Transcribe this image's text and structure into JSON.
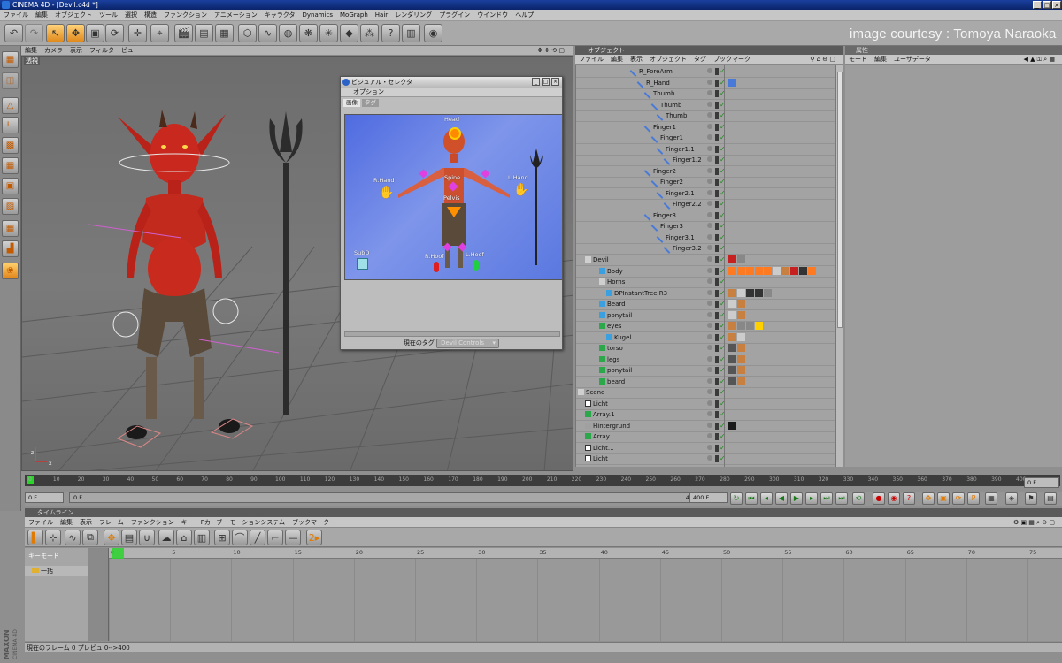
{
  "window": {
    "title": "CINEMA 4D - [Devil.c4d *]",
    "controls": [
      "_",
      "□",
      "×"
    ]
  },
  "watermark": "image courtesy : Tomoya Naraoka",
  "menubar": [
    "ファイル",
    "編集",
    "オブジェクト",
    "ツール",
    "選択",
    "構造",
    "ファンクション",
    "アニメーション",
    "キャラクタ",
    "Dynamics",
    "MoGraph",
    "Hair",
    "レンダリング",
    "プラグイン",
    "ウインドウ",
    "ヘルプ"
  ],
  "viewport": {
    "menu": [
      "編集",
      "カメラ",
      "表示",
      "フィルタ",
      "ビュー"
    ],
    "label": "透視"
  },
  "visual_selector": {
    "title": "ビジュアル・セレクタ",
    "options_menu": "オプション",
    "tabs": [
      "画像",
      "タグ"
    ],
    "labels": {
      "head": "Head",
      "spine": "Spine",
      "pelvis": "Pelvis",
      "r_hand": "R.Hand",
      "l_hand": "L.Hand",
      "subd": "SubD",
      "r_hoof": "R.Hoof",
      "l_hoof": "L.Hoof"
    },
    "current_tag_label": "現在のタグ",
    "current_tag_value": "Devil Controls"
  },
  "object_manager": {
    "title": "オブジェクト",
    "menu": [
      "ファイル",
      "編集",
      "表示",
      "オブジェクト",
      "タグ",
      "ブックマーク"
    ],
    "rows": [
      {
        "name": "R_ForeArm",
        "type": "bone"
      },
      {
        "name": "R_Hand",
        "type": "bone"
      },
      {
        "name": "Thumb",
        "type": "bone"
      },
      {
        "name": "Thumb",
        "type": "bone"
      },
      {
        "name": "Thumb",
        "type": "bone"
      },
      {
        "name": "Finger1",
        "type": "bone"
      },
      {
        "name": "Finger1",
        "type": "bone"
      },
      {
        "name": "Finger1.1",
        "type": "bone"
      },
      {
        "name": "Finger1.2",
        "type": "bone"
      },
      {
        "name": "Finger2",
        "type": "bone"
      },
      {
        "name": "Finger2",
        "type": "bone"
      },
      {
        "name": "Finger2.1",
        "type": "bone"
      },
      {
        "name": "Finger2.2",
        "type": "bone"
      },
      {
        "name": "Finger3",
        "type": "bone"
      },
      {
        "name": "Finger3",
        "type": "bone"
      },
      {
        "name": "Finger3.1",
        "type": "bone"
      },
      {
        "name": "Finger3.2",
        "type": "bone"
      },
      {
        "name": "Devil",
        "type": "null"
      },
      {
        "name": "Body",
        "type": "poly"
      },
      {
        "name": "Horns",
        "type": "null"
      },
      {
        "name": "DPInstantTree R3",
        "type": "poly"
      },
      {
        "name": "Beard",
        "type": "poly"
      },
      {
        "name": "ponytail",
        "type": "poly"
      },
      {
        "name": "eyes",
        "type": "sym"
      },
      {
        "name": "Kugel",
        "type": "poly"
      },
      {
        "name": "torso",
        "type": "sym"
      },
      {
        "name": "legs",
        "type": "sym"
      },
      {
        "name": "ponytail",
        "type": "sym"
      },
      {
        "name": "beard",
        "type": "sym"
      },
      {
        "name": "Scene",
        "type": "null"
      },
      {
        "name": "Licht",
        "type": "light"
      },
      {
        "name": "Array.1",
        "type": "array"
      },
      {
        "name": "Hintergrund",
        "type": "bg"
      },
      {
        "name": "Array",
        "type": "array"
      },
      {
        "name": "Licht.1",
        "type": "light"
      },
      {
        "name": "Licht",
        "type": "light"
      }
    ]
  },
  "attributes": {
    "title": "属性",
    "menu": [
      "モード",
      "編集",
      "ユーザデータ"
    ]
  },
  "timeline_ruler": [
    "0",
    "10",
    "20",
    "30",
    "40",
    "50",
    "60",
    "70",
    "80",
    "90",
    "100",
    "110",
    "120",
    "130",
    "140",
    "150",
    "160",
    "170",
    "180",
    "190",
    "200",
    "210",
    "220",
    "230",
    "240",
    "250",
    "260",
    "270",
    "280",
    "290",
    "300",
    "310",
    "320",
    "330",
    "340",
    "350",
    "360",
    "370",
    "380",
    "390",
    "400"
  ],
  "playback": {
    "current": "0 F",
    "start": "0 F",
    "end_field": "400 F",
    "end_field2": "400 F",
    "frame_box": "0 F"
  },
  "timeline": {
    "title": "タイムライン",
    "menu": [
      "ファイル",
      "編集",
      "表示",
      "フレーム",
      "ファンクション",
      "キー",
      "Fカーブ",
      "モーションシステム",
      "ブックマーク"
    ],
    "key_mode": "キーモード",
    "track": "一括",
    "ruler": [
      "0",
      "5",
      "10",
      "15",
      "20",
      "25",
      "30",
      "35",
      "40",
      "45",
      "50",
      "55",
      "60",
      "65",
      "70",
      "75"
    ]
  },
  "status": "現在のフレーム 0 プレビュ 0-->400",
  "brand": "MAXON CINEMA 4D"
}
